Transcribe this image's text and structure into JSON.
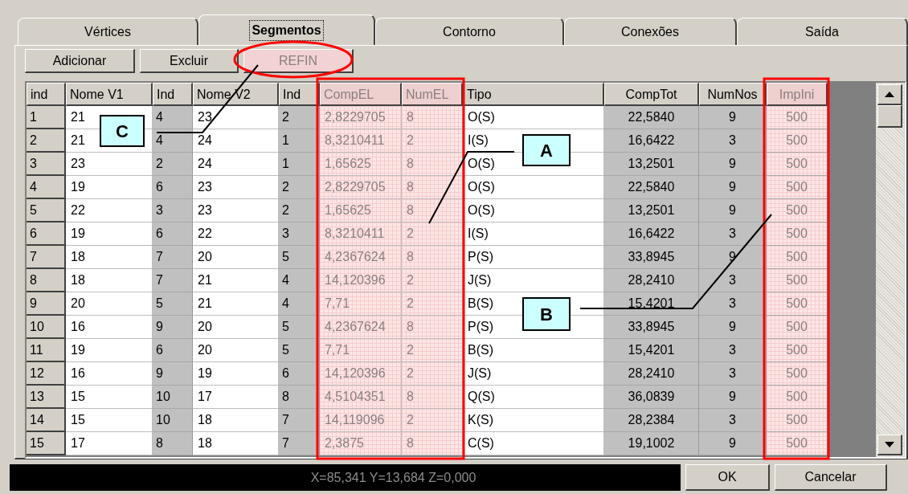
{
  "tabs": [
    {
      "label": "Vértices",
      "selected": false
    },
    {
      "label": "Segmentos",
      "selected": true
    },
    {
      "label": "Contorno",
      "selected": false
    },
    {
      "label": "Conexões",
      "selected": false
    },
    {
      "label": "Saída",
      "selected": false
    }
  ],
  "toolbar": [
    {
      "label": "Adicionar",
      "disabled": false,
      "highlighted": false
    },
    {
      "label": "Excluir",
      "disabled": false,
      "highlighted": false
    },
    {
      "label": "REFIN",
      "disabled": true,
      "highlighted": true
    }
  ],
  "table": {
    "columns": [
      {
        "label": "ind",
        "kind": "index",
        "highlighted": false
      },
      {
        "label": "Nome V1",
        "kind": "editable",
        "highlighted": false
      },
      {
        "label": "Ind",
        "kind": "linked",
        "highlighted": false
      },
      {
        "label": "Nome V2",
        "kind": "editable",
        "highlighted": false
      },
      {
        "label": "Ind",
        "kind": "linked",
        "highlighted": false
      },
      {
        "label": "CompEL",
        "kind": "editable",
        "highlighted": true
      },
      {
        "label": "NumEL",
        "kind": "editable",
        "highlighted": true
      },
      {
        "label": "Tipo",
        "kind": "editable",
        "highlighted": false
      },
      {
        "label": "CompTot",
        "kind": "computed",
        "highlighted": false
      },
      {
        "label": "NumNos",
        "kind": "computed",
        "highlighted": false
      },
      {
        "label": "ImpIni",
        "kind": "computed",
        "highlighted": true
      }
    ],
    "rows": [
      [
        "1",
        "21",
        "4",
        "23",
        "2",
        "2,8229705",
        "8",
        "O(S)",
        "22,5840",
        "9",
        "500"
      ],
      [
        "2",
        "21",
        "4",
        "24",
        "1",
        "8,3210411",
        "2",
        "I(S)",
        "16,6422",
        "3",
        "500"
      ],
      [
        "3",
        "23",
        "2",
        "24",
        "1",
        "1,65625",
        "8",
        "O(S)",
        "13,2501",
        "9",
        "500"
      ],
      [
        "4",
        "19",
        "6",
        "23",
        "2",
        "2,8229705",
        "8",
        "O(S)",
        "22,5840",
        "9",
        "500"
      ],
      [
        "5",
        "22",
        "3",
        "23",
        "2",
        "1,65625",
        "8",
        "O(S)",
        "13,2501",
        "9",
        "500"
      ],
      [
        "6",
        "19",
        "6",
        "22",
        "3",
        "8,3210411",
        "2",
        "I(S)",
        "16,6422",
        "3",
        "500"
      ],
      [
        "7",
        "18",
        "7",
        "20",
        "5",
        "4,2367624",
        "8",
        "P(S)",
        "33,8945",
        "9",
        "500"
      ],
      [
        "8",
        "18",
        "7",
        "21",
        "4",
        "14,120396",
        "2",
        "J(S)",
        "28,2410",
        "3",
        "500"
      ],
      [
        "9",
        "20",
        "5",
        "21",
        "4",
        "7,71",
        "2",
        "B(S)",
        "15,4201",
        "3",
        "500"
      ],
      [
        "10",
        "16",
        "9",
        "20",
        "5",
        "4,2367624",
        "8",
        "P(S)",
        "33,8945",
        "9",
        "500"
      ],
      [
        "11",
        "19",
        "6",
        "20",
        "5",
        "7,71",
        "2",
        "B(S)",
        "15,4201",
        "3",
        "500"
      ],
      [
        "12",
        "16",
        "9",
        "19",
        "6",
        "14,120396",
        "2",
        "J(S)",
        "28,2410",
        "3",
        "500"
      ],
      [
        "13",
        "15",
        "10",
        "17",
        "8",
        "4,5104351",
        "8",
        "Q(S)",
        "36,0839",
        "9",
        "500"
      ],
      [
        "14",
        "15",
        "10",
        "18",
        "7",
        "14,119096",
        "2",
        "K(S)",
        "28,2384",
        "3",
        "500"
      ],
      [
        "15",
        "17",
        "8",
        "18",
        "7",
        "2,3875",
        "8",
        "C(S)",
        "19,1002",
        "9",
        "500"
      ]
    ]
  },
  "status_bar": {
    "coordinates": "X=85,341 Y=13,684 Z=0,000"
  },
  "dialog_buttons": [
    {
      "label": "OK"
    },
    {
      "label": "Cancelar"
    }
  ],
  "annotations": [
    {
      "label": "C"
    },
    {
      "label": "A"
    },
    {
      "label": "B"
    }
  ]
}
